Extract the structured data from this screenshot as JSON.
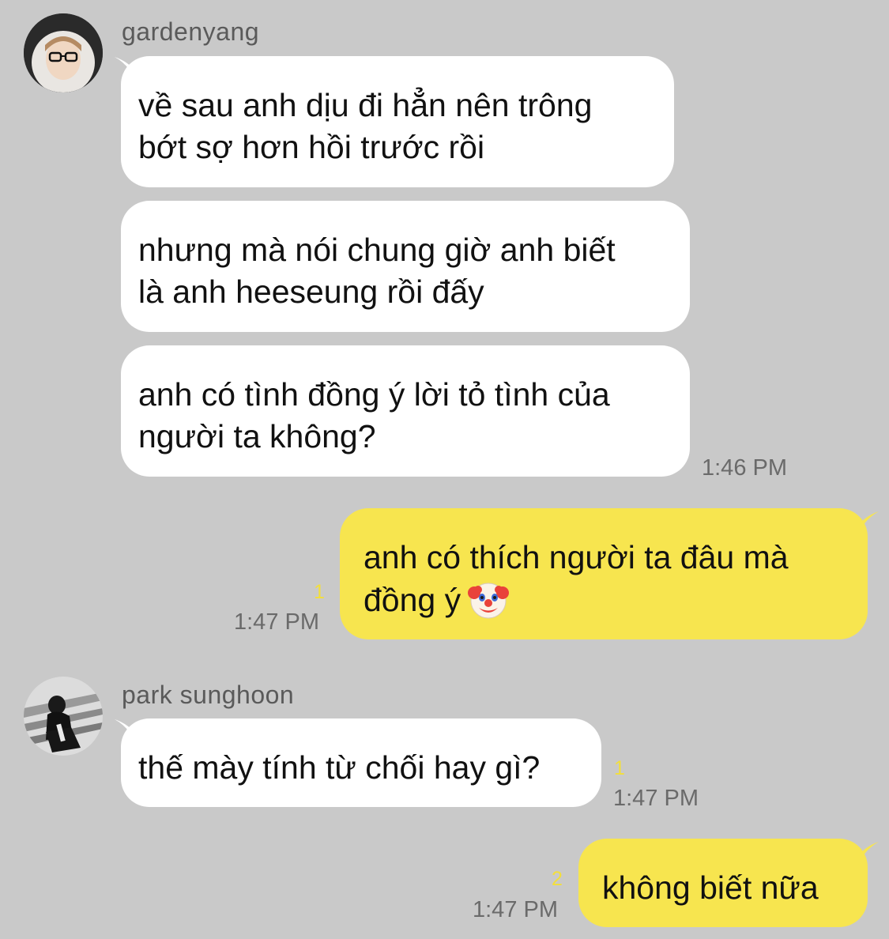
{
  "chat": {
    "groups": [
      {
        "sender": "gardenyang",
        "messages": [
          {
            "lines": [
              "về sau anh dịu đi hẳn nên trông",
              "bớt sợ hơn hồi trước rồi"
            ]
          },
          {
            "lines": [
              "nhưng mà nói chung giờ anh biết",
              "là anh heeseung rồi đấy"
            ]
          },
          {
            "lines": [
              "anh có tình đồng ý lời tỏ tình của",
              "người ta không?"
            ],
            "time": "1:46 PM"
          }
        ]
      },
      {
        "sender": "park sunghoon",
        "messages": [
          {
            "lines": [
              "thế mày tính từ chối hay gì?"
            ],
            "time": "1:47 PM",
            "unread": "1"
          }
        ]
      }
    ],
    "outgoing": [
      {
        "lines": [
          "anh có thích người ta đâu mà",
          "đồng ý "
        ],
        "emoji": "🤡",
        "time": "1:47 PM",
        "unread": "1"
      },
      {
        "lines": [
          "không biết nữa"
        ],
        "time": "1:47 PM",
        "unread": "2"
      }
    ]
  },
  "icons": {
    "avatar_1": "avatar-photo",
    "avatar_2": "avatar-photo",
    "emoji": "clown-face-icon"
  },
  "colors": {
    "background": "#c9c9c9",
    "incoming_bubble": "#ffffff",
    "outgoing_bubble": "#f7e54f",
    "unread_count": "#f3df3a"
  }
}
